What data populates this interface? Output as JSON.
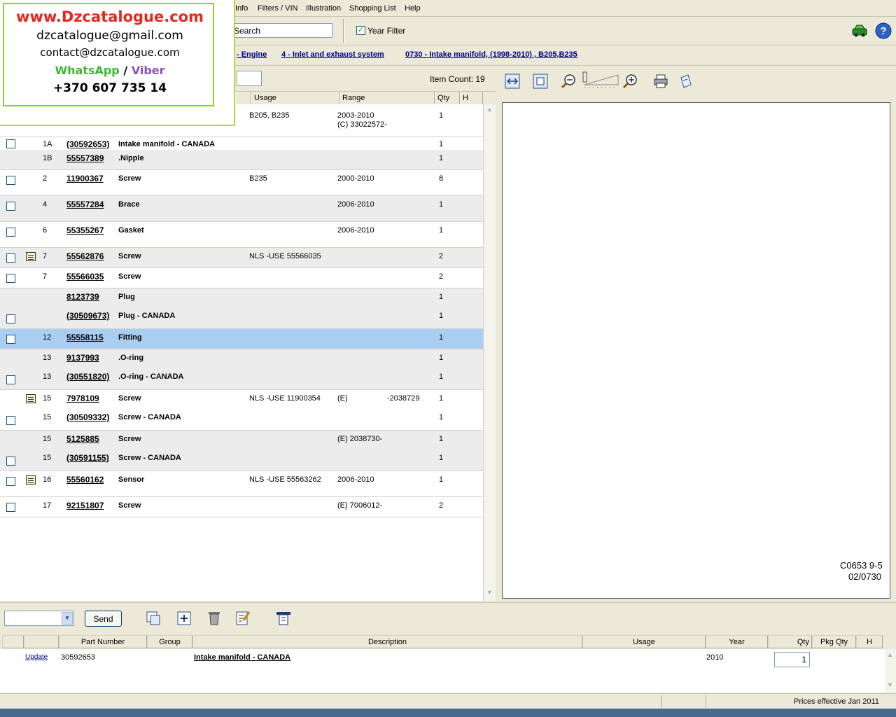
{
  "promo": {
    "website": "www.Dzcatalogue.com",
    "email1": "dzcatalogue@gmail.com",
    "email2": "contact@dzcatalogue.com",
    "whatsapp": "WhatsApp",
    "slash": "/",
    "viber": "Viber",
    "phone": "+370 607 735 14"
  },
  "menu": [
    "Info",
    "Filters / VIN",
    "Illustration",
    "Shopping List",
    "Help"
  ],
  "toolbar": {
    "search_value": "Search",
    "year_filter_label": "Year Filter",
    "year_filter_checked": "✓"
  },
  "breadcrumb": [
    "- Engine",
    "4 - Inlet and exhaust system",
    "0730 - Intake manifold, (1998-2010) , B205,B235"
  ],
  "parts": {
    "item_count": "Item Count: 19",
    "columns": [
      "Usage",
      "Range",
      "Qty",
      "H"
    ],
    "rows": [
      {
        "item": "",
        "part": "",
        "desc": "",
        "usage": "B205, B235",
        "range": "2003-2010",
        "range2": "(C) 33022572-",
        "range_end": "",
        "qty": "1"
      },
      {
        "item": "1A",
        "part": "(30592653)",
        "desc": "Intake manifold - CANADA",
        "usage": "",
        "range": "",
        "range2": "",
        "range_end": "",
        "qty": "1"
      },
      {
        "item": "1B",
        "part": "55557389",
        "desc": ".Nipple",
        "usage": "",
        "range": "",
        "range2": "",
        "range_end": "",
        "qty": "1"
      },
      {
        "item": "2",
        "part": "11900367",
        "desc": "Screw",
        "usage": "B235",
        "range": "2000-2010",
        "range2": "",
        "range_end": "",
        "qty": "8"
      },
      {
        "item": "4",
        "part": "55557284",
        "desc": "Brace",
        "usage": "",
        "range": "2006-2010",
        "range2": "",
        "range_end": "",
        "qty": "1"
      },
      {
        "item": "6",
        "part": "55355267",
        "desc": "Gasket",
        "usage": "",
        "range": "2006-2010",
        "range2": "",
        "range_end": "",
        "qty": "1"
      },
      {
        "item": "7",
        "part": "55562876",
        "desc": "Screw",
        "usage": "NLS -USE 55566035",
        "range": "",
        "range2": "",
        "range_end": "",
        "qty": "2"
      },
      {
        "item": "7",
        "part": "55566035",
        "desc": "Screw",
        "usage": "",
        "range": "",
        "range2": "",
        "range_end": "",
        "qty": "2"
      },
      {
        "item": "",
        "part": "8123739",
        "desc": "Plug",
        "usage": "",
        "range": "",
        "range2": "",
        "range_end": "",
        "qty": "1"
      },
      {
        "item": "",
        "part": "(30509673)",
        "desc": "Plug - CANADA",
        "usage": "",
        "range": "",
        "range2": "",
        "range_end": "",
        "qty": "1"
      },
      {
        "item": "12",
        "part": "55558115",
        "desc": "Fitting",
        "usage": "",
        "range": "",
        "range2": "",
        "range_end": "",
        "qty": "1"
      },
      {
        "item": "13",
        "part": "9137993",
        "desc": ".O-ring",
        "usage": "",
        "range": "",
        "range2": "",
        "range_end": "",
        "qty": "1"
      },
      {
        "item": "13",
        "part": "(30551820)",
        "desc": ".O-ring - CANADA",
        "usage": "",
        "range": "",
        "range2": "",
        "range_end": "",
        "qty": "1"
      },
      {
        "item": "15",
        "part": "7978109",
        "desc": "Screw",
        "usage": "NLS -USE 11900354",
        "range": "(E)",
        "range2": "",
        "range_end": "-2038729",
        "qty": "1"
      },
      {
        "item": "15",
        "part": "(30509332)",
        "desc": "Screw - CANADA",
        "usage": "",
        "range": "",
        "range2": "",
        "range_end": "",
        "qty": "1"
      },
      {
        "item": "15",
        "part": "5125885",
        "desc": "Screw",
        "usage": "",
        "range": "(E) 2038730-",
        "range2": "",
        "range_end": "",
        "qty": "1"
      },
      {
        "item": "15",
        "part": "(30591155)",
        "desc": "Screw - CANADA",
        "usage": "",
        "range": "",
        "range2": "",
        "range_end": "",
        "qty": "1"
      },
      {
        "item": "16",
        "part": "55560162",
        "desc": "Sensor",
        "usage": "NLS -USE 55563262",
        "range": "2006-2010",
        "range2": "",
        "range_end": "",
        "qty": "1"
      },
      {
        "item": "17",
        "part": "92151807",
        "desc": "Screw",
        "usage": "",
        "range": "(E) 7006012-",
        "range2": "",
        "range_end": "",
        "qty": "2"
      }
    ]
  },
  "illustration": {
    "ref_code": "C0653 9-5",
    "ref_page": "02/0730"
  },
  "cart": {
    "send_label": "Send",
    "columns": [
      "Part Number",
      "Group",
      "Description",
      "Usage",
      "Year",
      "Qty",
      "Pkg Qty",
      "H"
    ],
    "row": {
      "action": "Update",
      "part": "30592653",
      "desc": "Intake manifold - CANADA",
      "year": "2010",
      "qty": "1"
    }
  },
  "status": {
    "prices": "Prices effective Jan 2011"
  }
}
